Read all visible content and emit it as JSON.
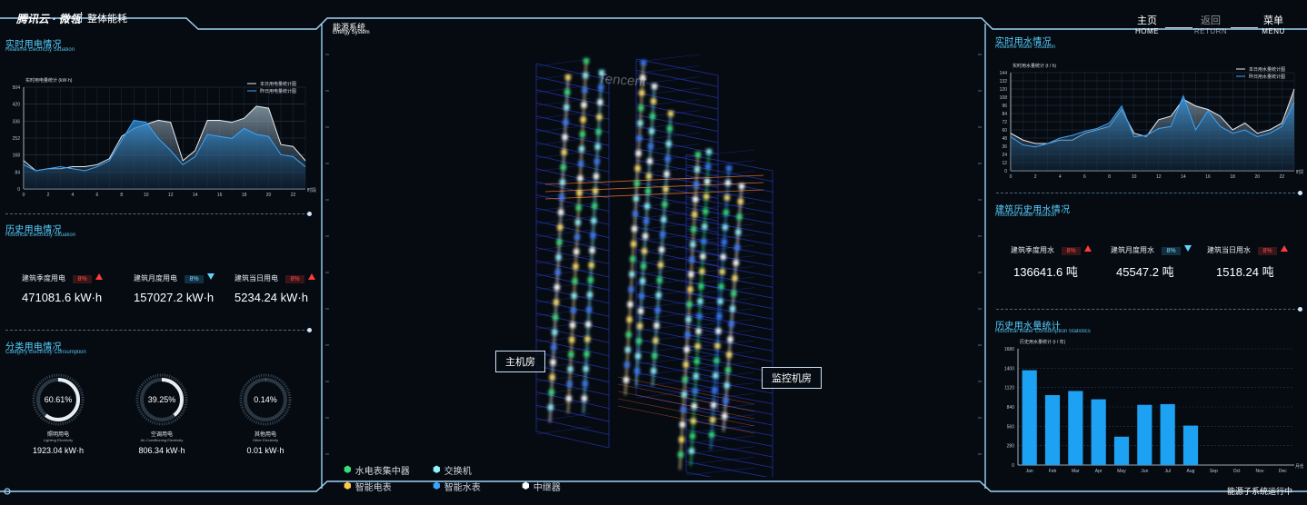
{
  "header": {
    "logo": "腾讯云 · 微瓴",
    "title": "整体能耗",
    "nav": [
      {
        "cn": "主页",
        "en": "HOME"
      },
      {
        "cn": "返回",
        "en": "RETURN"
      },
      {
        "cn": "菜单",
        "en": "MENU"
      }
    ]
  },
  "left": {
    "realtime": {
      "title_cn": "实时用电情况",
      "title_en": "Realtime Electricity Situation",
      "chart_ylabel": "实时用电量统计 (kW·h)",
      "legend_today": "本日用电量统计图",
      "legend_yesterday": "昨日用电量统计图",
      "xunit": "时段"
    },
    "history": {
      "title_cn": "历史用电情况",
      "title_en": "Historical Electricity Situation",
      "stats": [
        {
          "label": "建筑季度用电",
          "pct": "8%",
          "trend": "up",
          "value": "471081.6 kW·h"
        },
        {
          "label": "建筑月度用电",
          "pct": "8%",
          "trend": "down",
          "value": "157027.2 kW·h"
        },
        {
          "label": "建筑当日用电",
          "pct": "8%",
          "trend": "up",
          "value": "5234.24 kW·h"
        }
      ]
    },
    "category": {
      "title_cn": "分类用电情况",
      "title_en": "Category Electricity Consumption",
      "gauges": [
        {
          "pct_text": "60.61%",
          "pct": 0.6061,
          "name_cn": "照明用电",
          "name_en": "Lighting Electricity",
          "value": "1923.04 kW·h"
        },
        {
          "pct_text": "39.25%",
          "pct": 0.3925,
          "name_cn": "空调用电",
          "name_en": "Air-Conditioning Electricity",
          "value": "806.34 kW·h"
        },
        {
          "pct_text": "0.14%",
          "pct": 0.0014,
          "name_cn": "其他用电",
          "name_en": "Other Electricity",
          "value": "0.01 kW·h"
        }
      ]
    }
  },
  "center": {
    "title_cn": "能源系统",
    "title_en": "Energy System",
    "rooms": [
      "主机房",
      "监控机房"
    ],
    "building_logo": "Tencent",
    "legend": [
      {
        "label": "水电表集中器",
        "color": "#35e07a"
      },
      {
        "label": "交换机",
        "color": "#8ff3ff"
      },
      {
        "label": "智能电表",
        "color": "#ffc84a"
      },
      {
        "label": "智能水表",
        "color": "#3aa3ff"
      },
      {
        "label": "中继器",
        "color": "#ffffff"
      }
    ]
  },
  "right": {
    "realtime": {
      "title_cn": "实时用水情况",
      "title_en": "Realtime Water Situation",
      "chart_ylabel": "实时用水量统计 (t / h)",
      "legend_today": "本日用水量统计图",
      "legend_yesterday": "昨日用水量统计图",
      "xunit": "时段"
    },
    "history": {
      "title_cn": "建筑历史用水情况",
      "title_en": "Historical Water Situation",
      "stats": [
        {
          "label": "建筑季度用水",
          "pct": "8%",
          "trend": "up",
          "value": "136641.6 吨"
        },
        {
          "label": "建筑月度用水",
          "pct": "8%",
          "trend": "down",
          "value": "45547.2 吨"
        },
        {
          "label": "建筑当日用水",
          "pct": "8%",
          "trend": "up",
          "value": "1518.24 吨"
        }
      ]
    },
    "stats": {
      "title_cn": "历史用水量统计",
      "title_en": "Historical Water Consumption Statistics",
      "chart_ylabel": "历史用水量统计 (t / 年)",
      "xunit": "月份"
    }
  },
  "footer": {
    "status": "能源子系统运行中"
  },
  "chart_data": [
    {
      "type": "area",
      "title": "实时用电量统计 (kW·h)",
      "ylim": [
        0,
        504
      ],
      "yticks": [
        0,
        84,
        168,
        252,
        336,
        420,
        504
      ],
      "xticks": [
        0,
        2,
        4,
        6,
        8,
        10,
        12,
        14,
        16,
        18,
        20,
        22
      ],
      "xlim": [
        0,
        23
      ],
      "x": [
        0,
        1,
        2,
        3,
        4,
        5,
        6,
        7,
        8,
        9,
        10,
        11,
        12,
        13,
        14,
        15,
        16,
        17,
        18,
        19,
        20,
        21,
        22,
        23
      ],
      "series": [
        {
          "name": "本日用电量统计图",
          "color": "#e6edf3",
          "values": [
            140,
            90,
            100,
            100,
            110,
            110,
            120,
            150,
            260,
            300,
            320,
            340,
            330,
            140,
            190,
            340,
            340,
            330,
            350,
            410,
            400,
            220,
            210,
            140
          ]
        },
        {
          "name": "昨日用电量统计图",
          "color": "#3aa6ff",
          "values": [
            120,
            90,
            100,
            110,
            100,
            90,
            110,
            140,
            240,
            340,
            330,
            250,
            190,
            120,
            160,
            270,
            260,
            250,
            300,
            270,
            260,
            170,
            160,
            110
          ]
        }
      ],
      "grid": true,
      "legend": "top-right"
    },
    {
      "type": "area",
      "title": "实时用水量统计 (t / h)",
      "ylim": [
        0,
        144
      ],
      "yticks": [
        0,
        12,
        24,
        36,
        48,
        60,
        72,
        84,
        96,
        108,
        120,
        132,
        144
      ],
      "xticks": [
        0,
        2,
        4,
        6,
        8,
        10,
        12,
        14,
        16,
        18,
        20,
        22
      ],
      "xlim": [
        0,
        23
      ],
      "x": [
        0,
        1,
        2,
        3,
        4,
        5,
        6,
        7,
        8,
        9,
        10,
        11,
        12,
        13,
        14,
        15,
        16,
        17,
        18,
        19,
        20,
        21,
        22,
        23
      ],
      "series": [
        {
          "name": "本日用水量统计图",
          "color": "#e6edf3",
          "values": [
            55,
            45,
            40,
            40,
            45,
            45,
            55,
            60,
            65,
            90,
            55,
            50,
            75,
            80,
            105,
            95,
            90,
            80,
            60,
            70,
            55,
            60,
            70,
            120
          ]
        },
        {
          "name": "昨日用水量统计图",
          "color": "#3aa6ff",
          "values": [
            50,
            38,
            35,
            40,
            48,
            52,
            58,
            62,
            70,
            95,
            50,
            52,
            62,
            65,
            110,
            60,
            88,
            65,
            55,
            60,
            50,
            55,
            65,
            100
          ]
        }
      ],
      "grid": true,
      "legend": "top-right"
    },
    {
      "type": "bar",
      "title": "历史用水量统计 (t / 年)",
      "ylim": [
        0,
        1680
      ],
      "yticks": [
        0,
        280,
        560,
        840,
        1120,
        1400,
        1680
      ],
      "categories": [
        "Jan",
        "Feb",
        "Mar",
        "Apr",
        "May",
        "Jun",
        "Jul",
        "Aug",
        "Sep",
        "Oct",
        "Nov",
        "Dec"
      ],
      "values": [
        1370,
        1010,
        1070,
        950,
        410,
        870,
        880,
        570,
        0,
        0,
        0,
        0
      ],
      "color": "#1da1f2",
      "grid": true
    }
  ]
}
